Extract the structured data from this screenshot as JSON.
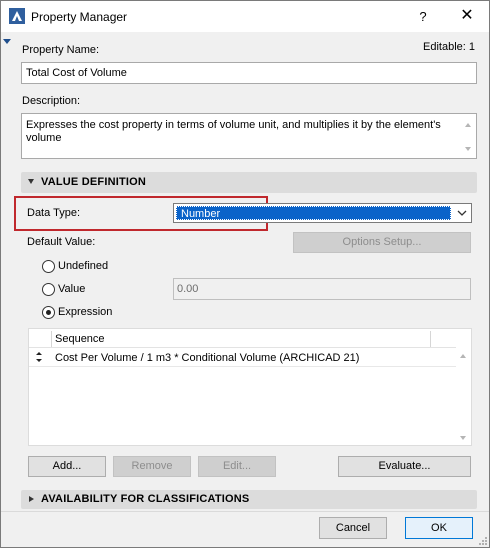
{
  "window": {
    "title": "Property Manager",
    "help_label": "?",
    "close_label": "✕"
  },
  "property": {
    "name_label": "Property Name:",
    "editable_label": "Editable: 1",
    "name_value": "Total Cost of Volume",
    "description_label": "Description:",
    "description_value": "Expresses the cost property in terms of volume unit, and multiplies it by the element's volume"
  },
  "value_definition": {
    "header": "VALUE DEFINITION",
    "data_type_label": "Data Type:",
    "data_type_value": "Number",
    "default_value_label": "Default Value:",
    "options_setup_label": "Options Setup...",
    "radio_undefined": "Undefined",
    "radio_value": "Value",
    "radio_expression": "Expression",
    "selected_radio": "Expression",
    "value_field": "0.00",
    "list": {
      "column_header": "Sequence",
      "rows": [
        {
          "text": "Cost Per Volume / 1 m3 * Conditional Volume (ARCHICAD 21)"
        }
      ]
    },
    "buttons": {
      "add": "Add...",
      "remove": "Remove",
      "edit": "Edit...",
      "evaluate": "Evaluate..."
    }
  },
  "availability": {
    "header": "AVAILABILITY FOR CLASSIFICATIONS"
  },
  "footer": {
    "cancel": "Cancel",
    "ok": "OK"
  },
  "colors": {
    "selection_blue": "#0b63c9",
    "highlight_red": "#c0282d",
    "primary_border": "#0078d7"
  }
}
